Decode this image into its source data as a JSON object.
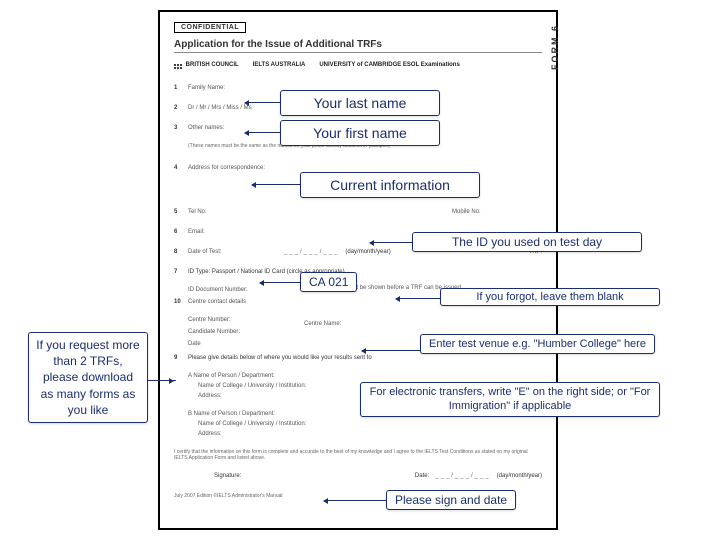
{
  "form": {
    "confidential": "CONFIDENTIAL",
    "formCode": "FORM   6",
    "title": "Application for the Issue of Additional TRFs",
    "logos": {
      "british": "BRITISH\nCOUNCIL",
      "ielts": "IELTS\nAUSTRALIA",
      "cambridge": "UNIVERSITY of CAMBRIDGE\nESOL Examinations"
    },
    "fields": {
      "f1": "Family Name:",
      "f2": "Dr / Mr / Mrs / Miss / Ms",
      "f3": "Other names:",
      "note3": "(These names must be the same as the names on your photo identity document / passport)",
      "f4": "Address for correspondence:",
      "f5": "Tel No:",
      "mobile": "Mobile No:",
      "f6": "Email:",
      "f7": "ID Type:  Passport / National ID Card  (circle as appropriate)",
      "idDoc": "ID Document Number:",
      "f8": "Date of Test:",
      "dateHint": "(day/month/year)",
      "trfLabel": "TRF:",
      "trfNote": "This document must be shown before a TRF can be issued",
      "contacts": "Centre contact details",
      "centreNum": "Centre Number:",
      "candNum": "Candidate Number:",
      "date": "Date",
      "centreName": "Centre Name:",
      "f9": "Please give details below of where you would like your results sent to",
      "a": "A   Name of Person / Department:",
      "college": "Name of College / University / Institution:",
      "address": "Address:",
      "b": "B   Name of Person / Department:",
      "declare": "I certify that the information on this form is complete and accurate to the best of my knowledge and I agree to the IELTS Test Conditions as stated on my original IELTS Application Form and listed above.",
      "sig": "Signature:",
      "dateBottom": "Date:",
      "dateHint2": "(day/month/year)",
      "footer": "July 2007 Edition    ©IELTS Administrator's Manual"
    }
  },
  "callouts": {
    "lastName": "Your last name",
    "firstName": "Your first name",
    "currentInfo": "Current information",
    "idUsed": "The ID you used on test day",
    "ca021": "CA 021",
    "forgot": "If you forgot, leave them blank",
    "leftBox": "If you request more than 2 TRFs, please download as many forms as you like",
    "venue": "Enter test venue e.g. \"Humber College\" here",
    "electronic": "For electronic transfers, write \"E\" on the right side; or \"For Immigration\" if applicable",
    "signDate": "Please sign and date"
  }
}
